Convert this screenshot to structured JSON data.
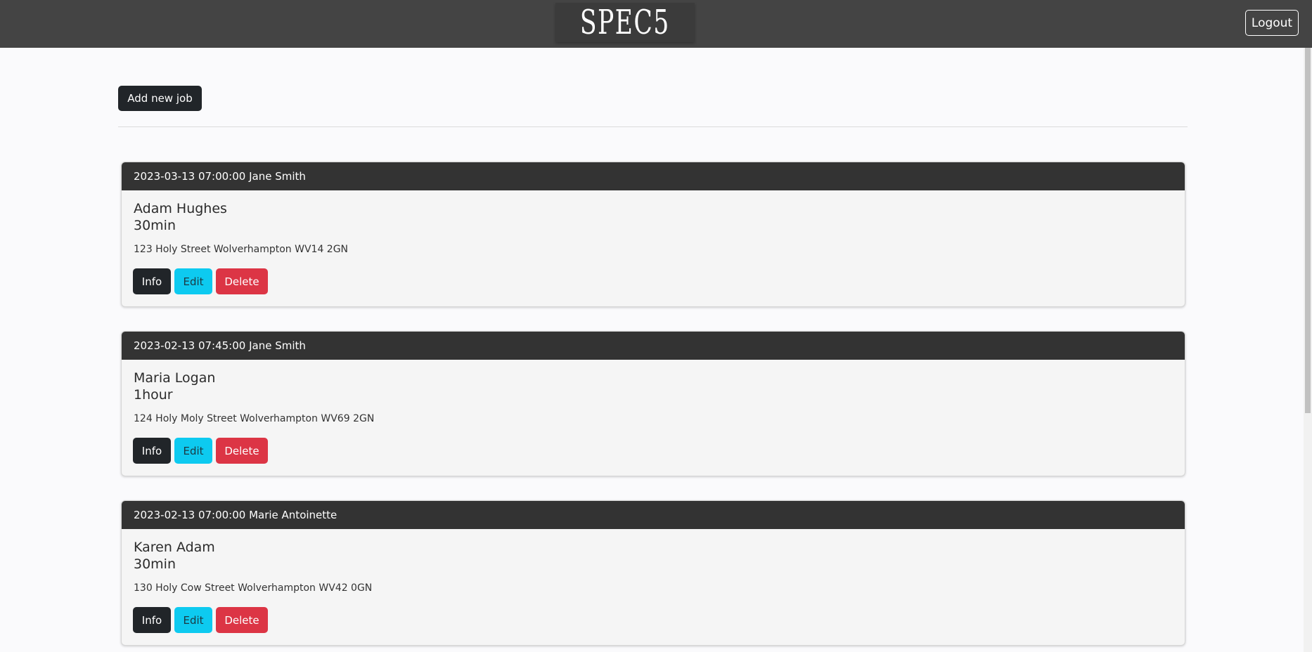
{
  "header": {
    "logo_text": "SPEC5",
    "logout_label": "Logout"
  },
  "actions": {
    "add_job_label": "Add new job"
  },
  "jobs": [
    {
      "header": "2023-03-13 07:00:00 Jane Smith",
      "name": "Adam Hughes",
      "duration": "30min",
      "address": "123 Holy Street Wolverhampton WV14 2GN",
      "info_label": "Info",
      "edit_label": "Edit",
      "delete_label": "Delete"
    },
    {
      "header": "2023-02-13 07:45:00 Jane Smith",
      "name": "Maria Logan",
      "duration": "1hour",
      "address": "124 Holy Moly Street Wolverhampton WV69 2GN",
      "info_label": "Info",
      "edit_label": "Edit",
      "delete_label": "Delete"
    },
    {
      "header": "2023-02-13 07:00:00 Marie Antoinette",
      "name": "Karen Adam",
      "duration": "30min",
      "address": "130 Holy Cow Street Wolverhampton WV42 0GN",
      "info_label": "Info",
      "edit_label": "Edit",
      "delete_label": "Delete"
    }
  ],
  "colors": {
    "navbar": "#444444",
    "card_header": "#333333",
    "btn_dark": "#212529",
    "btn_info": "#0dcaf0",
    "btn_danger": "#dc3545"
  }
}
